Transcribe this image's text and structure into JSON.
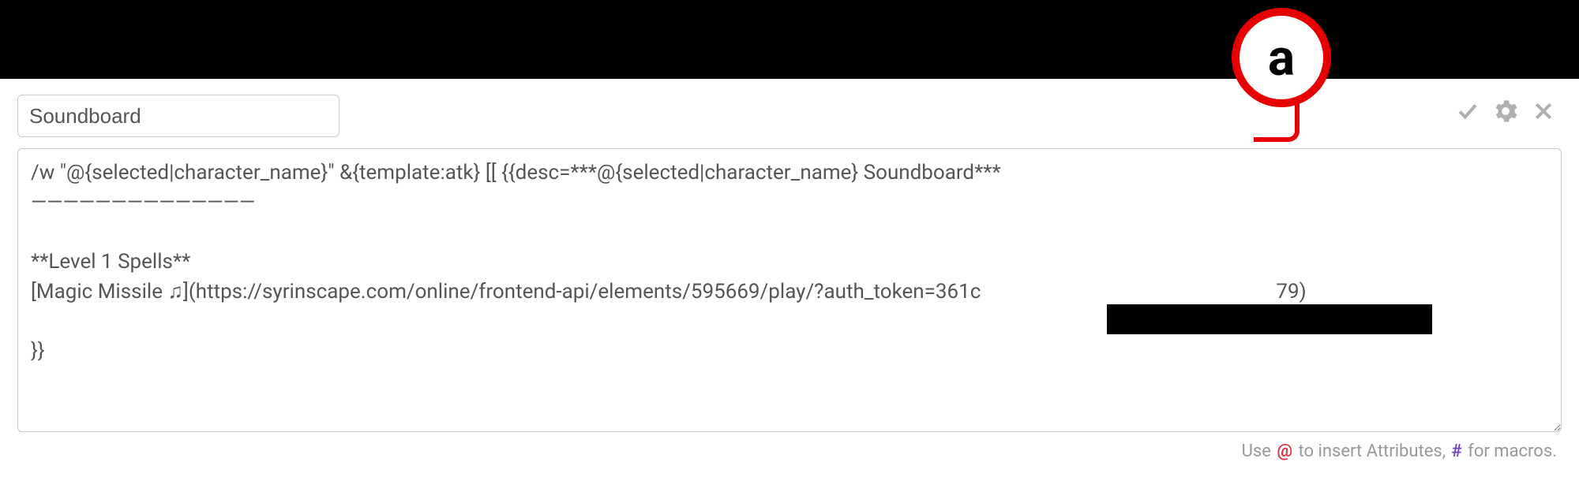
{
  "macro": {
    "name": "Soundboard",
    "body": "/w \"@{selected|character_name}\" &{template:atk} [[ {{desc=***@{selected|character_name} Soundboard***\n――――――――――――――\n\n**Level 1 Spells**\n[Magic Missile ♫](https://syrinscape.com/online/frontend-api/elements/595669/play/?auth_token=361c                                                          79)\n\n}}"
  },
  "actions": {
    "confirm": "check-icon",
    "settings": "gear-icon",
    "close": "x-icon"
  },
  "footer": {
    "prefix": "Use ",
    "attr_symbol": "@",
    "attr_text": " to insert Attributes, ",
    "macro_symbol": "#",
    "macro_text": " for macros."
  },
  "annotation": {
    "label": "a"
  }
}
